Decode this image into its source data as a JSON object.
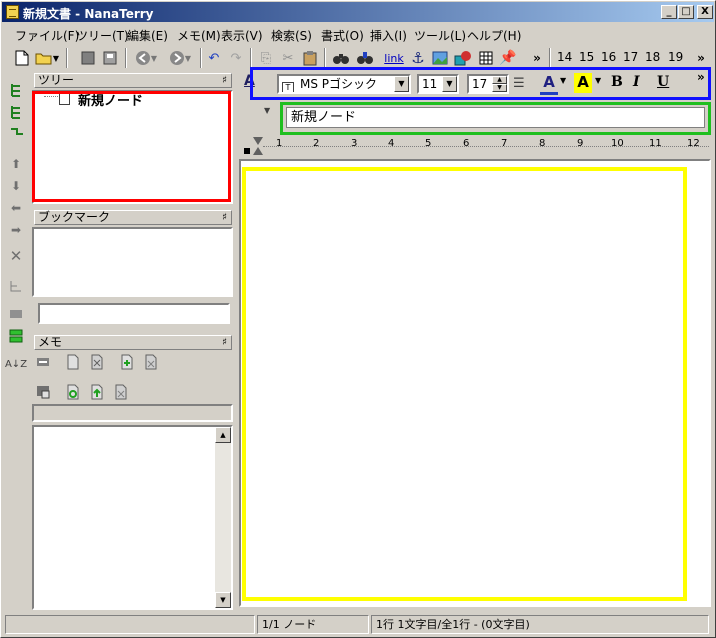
{
  "window": {
    "title": "新規文書 - NanaTerry",
    "minimize": "_",
    "maximize": "□",
    "close": "X"
  },
  "menu": [
    "ファイル(F)",
    "ツリー(T)",
    "編集(E)",
    "メモ(M)",
    "表示(V)",
    "検索(S)",
    "書式(O)",
    "挿入(I)",
    "ツール(L)",
    "ヘルプ(H)"
  ],
  "toolbar": {
    "link_label": "link",
    "overflow": "»",
    "numbers": [
      "14",
      "15",
      "16",
      "17",
      "18",
      "19"
    ]
  },
  "tree_pane": {
    "title": "ツリー",
    "pin": "♯",
    "node": "新規ノード"
  },
  "bookmark_pane": {
    "title": "ブックマーク",
    "pin": "♯"
  },
  "memo_pane": {
    "title": "メモ",
    "pin": "♯"
  },
  "format_bar": {
    "font_name": "MS Pゴシック",
    "font_size": "11",
    "line_spacing": "17",
    "bold": "B",
    "italic": "I",
    "underline": "U",
    "font_color_letter": "A",
    "highlight_letter": "A",
    "overflow": "»"
  },
  "node_name": "新規ノード",
  "ruler_numbers": [
    "1",
    "2",
    "3",
    "4",
    "5",
    "6",
    "7",
    "8",
    "9",
    "10",
    "11",
    "12"
  ],
  "status": {
    "node_count": "1/1 ノード",
    "position": "1行 1文字目/全1行 - (0文字目)"
  },
  "colors": {
    "tree_highlight": "#ff0000",
    "format_highlight": "#1010ff",
    "name_highlight": "#1fbf1f",
    "editor_highlight": "#ffff00"
  }
}
